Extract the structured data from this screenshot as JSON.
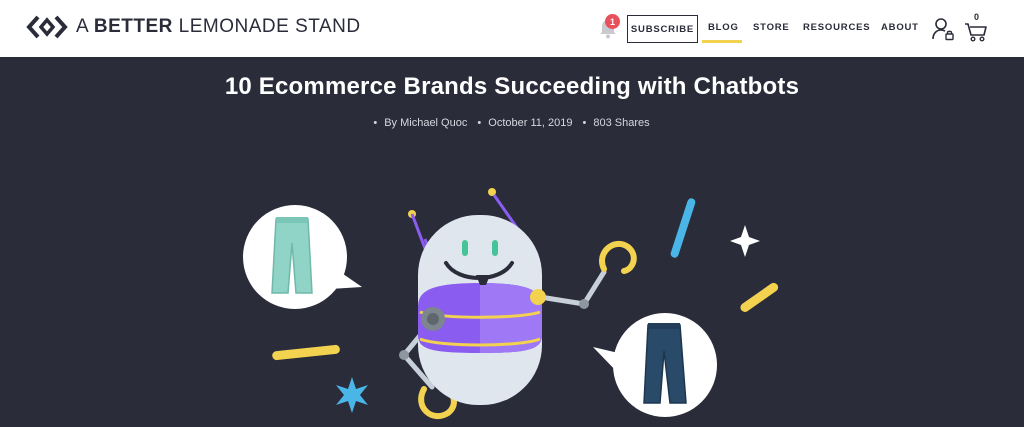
{
  "header": {
    "brand": {
      "part1": "A ",
      "part2": "BETTER",
      "part3": " LEMONADE STAND"
    },
    "notifications_count": "1",
    "subscribe_label": "SUBSCRIBE",
    "nav": {
      "blog": "BLOG",
      "store": "STORE",
      "resources": "RESOURCES",
      "about": "ABOUT"
    },
    "cart_count": "0",
    "active_nav": "BLOG"
  },
  "article": {
    "title": "10 Ecommerce Brands Succeeding with Chatbots",
    "author": "By Michael Quoc",
    "date": "October 11, 2019",
    "shares": "803 Shares"
  },
  "colors": {
    "hero_bg": "#2a2c3a",
    "accent_yellow": "#f2d24e",
    "robot_purple": "#8a5cf0",
    "accent_blue": "#4ab6e8",
    "badge_red": "#e8505b"
  },
  "icons": {
    "logo": "brand-chevrons-icon",
    "bell": "bell-icon",
    "user": "user-lock-icon",
    "cart": "cart-icon"
  }
}
